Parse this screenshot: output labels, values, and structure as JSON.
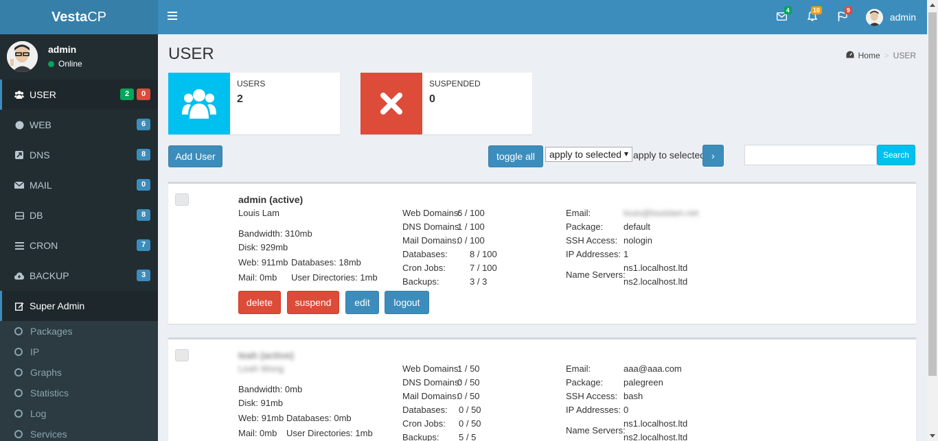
{
  "app": {
    "logo_bold": "Vesta",
    "logo_rest": "CP"
  },
  "sidebar": {
    "user": {
      "name": "admin",
      "status": "Online"
    },
    "items": [
      {
        "label": "USER",
        "icon": "users-icon",
        "badges": [
          "2",
          "0"
        ],
        "badge_colors": [
          "#00a65a",
          "#dd4b39"
        ]
      },
      {
        "label": "WEB",
        "icon": "globe-icon",
        "badges": [
          "6"
        ]
      },
      {
        "label": "DNS",
        "icon": "external-link-icon",
        "badges": [
          "8"
        ]
      },
      {
        "label": "MAIL",
        "icon": "envelope-icon",
        "badges": [
          "0"
        ]
      },
      {
        "label": "DB",
        "icon": "database-icon",
        "badges": [
          "8"
        ]
      },
      {
        "label": "CRON",
        "icon": "list-icon",
        "badges": [
          "7"
        ]
      },
      {
        "label": "BACKUP",
        "icon": "cloud-download-icon",
        "badges": [
          "3"
        ]
      },
      {
        "label": "Super Admin",
        "icon": "edit-icon",
        "badges": []
      }
    ],
    "submenu": [
      "Packages",
      "IP",
      "Graphs",
      "Statistics",
      "Log",
      "Services"
    ]
  },
  "header": {
    "notifications": [
      {
        "icon": "envelope-icon",
        "count": "4",
        "color": "#00a65a"
      },
      {
        "icon": "bell-icon",
        "count": "10",
        "color": "#f39c12"
      },
      {
        "icon": "flag-icon",
        "count": "9",
        "color": "#dd4b39"
      }
    ],
    "user_name": "admin"
  },
  "page": {
    "title": "USER",
    "breadcrumb": {
      "home": "Home",
      "current": "USER"
    }
  },
  "stats": [
    {
      "label": "USERS",
      "value": "2",
      "color": "#00c0ef",
      "icon": "users-icon"
    },
    {
      "label": "SUSPENDED",
      "value": "0",
      "color": "#dd4b39",
      "icon": "x-icon"
    }
  ],
  "toolbar": {
    "add_user": "Add User",
    "toggle_all": "toggle all",
    "select_value": "apply to selected",
    "apply_label": "apply to selected",
    "go": "›",
    "search_button": "Search",
    "search_value": ""
  },
  "users": [
    {
      "title": "admin (active)",
      "full_name": "Louis Lam",
      "bandwidth": "Bandwidth: 310mb",
      "disk": "Disk: 929mb",
      "web": "Web: 911mb",
      "databases_usage": "Databases: 18mb",
      "mail": "Mail: 0mb",
      "user_dirs": "User Directories: 1mb",
      "quota_labels": [
        "Web Domains:",
        "DNS Domains:",
        "Mail Domains:",
        "Databases:",
        "Cron Jobs:",
        "Backups:"
      ],
      "quota_values": [
        "6 / 100",
        "1 / 100",
        "0 / 100",
        "8 / 100",
        "7 / 100",
        "3 / 3"
      ],
      "email_label": "Email:",
      "email": "louis@louislam.net",
      "package_label": "Package:",
      "package": "default",
      "ssh_label": "SSH Access:",
      "ssh": "nologin",
      "ip_label": "IP Addresses:",
      "ip": "1",
      "ns_label": "Name Servers:",
      "ns": [
        "ns1.localhost.ltd",
        "ns2.localhost.ltd"
      ],
      "actions": [
        "delete",
        "suspend",
        "edit",
        "logout"
      ]
    },
    {
      "title": "leah (active)",
      "full_name": "Leah Wong",
      "bandwidth": "Bandwidth: 0mb",
      "disk": "Disk: 91mb",
      "web": "Web: 91mb",
      "databases_usage": "Databases: 0mb",
      "mail": "Mail: 0mb",
      "user_dirs": "User Directories: 1mb",
      "quota_labels": [
        "Web Domains:",
        "DNS Domains:",
        "Mail Domains:",
        "Databases:",
        "Cron Jobs:",
        "Backups:"
      ],
      "quota_values": [
        "1 / 50",
        "0 / 50",
        "0 / 50",
        "0 / 50",
        "0 / 50",
        "5 / 5"
      ],
      "email_label": "Email:",
      "email": "aaa@aaa.com",
      "package_label": "Package:",
      "package": "palegreen",
      "ssh_label": "SSH Access:",
      "ssh": "bash",
      "ip_label": "IP Addresses:",
      "ip": "0",
      "ns_label": "Name Servers:",
      "ns": [
        "ns1.localhost.ltd",
        "ns2.localhost.ltd"
      ]
    }
  ]
}
